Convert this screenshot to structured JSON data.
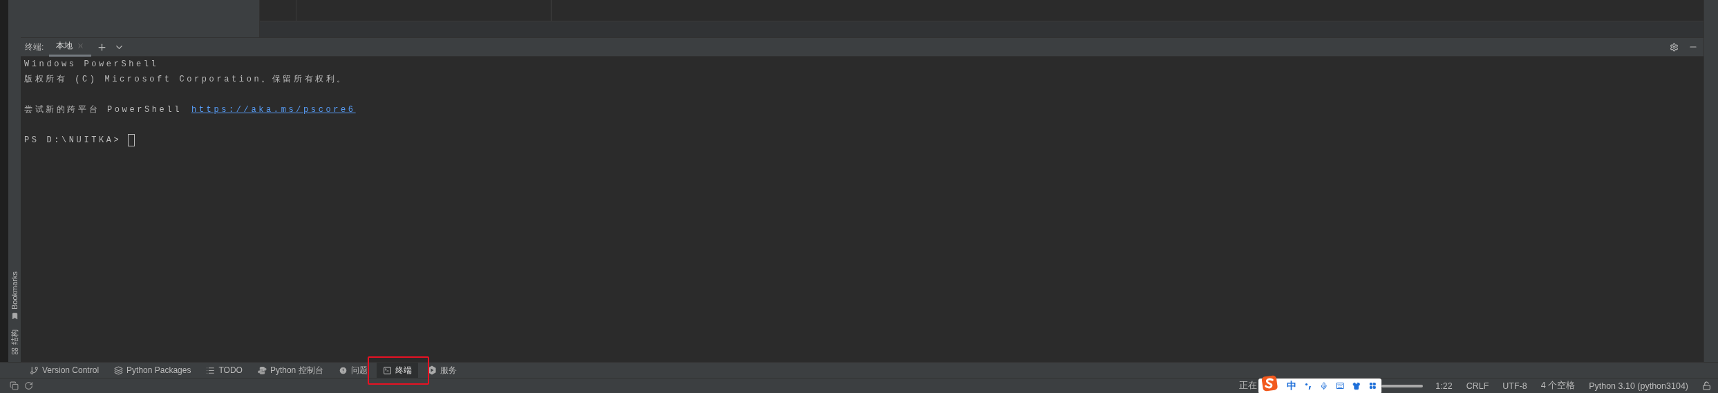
{
  "left_strip": [
    {
      "label": "Bookmarks",
      "kind": "bookmark"
    },
    {
      "label": "结构",
      "kind": "structure"
    }
  ],
  "terminal": {
    "label": "终端:",
    "tabs": [
      {
        "label": "本地",
        "selected": true
      }
    ],
    "lines": [
      {
        "kind": "text",
        "text": "Windows PowerShell"
      },
      {
        "kind": "text",
        "text": "版权所有 (C) Microsoft Corporation。保留所有权利。"
      },
      {
        "kind": "blank"
      },
      {
        "kind": "link_line",
        "text": "尝试新的跨平台 PowerShell",
        "link": "https://aka.ms/pscore6"
      },
      {
        "kind": "blank"
      },
      {
        "kind": "prompt",
        "text": "PS D:\\NUITKA>"
      }
    ]
  },
  "tool_tabs": [
    {
      "label": "Version Control",
      "kind": "branch",
      "selected": false,
      "highlighted": false
    },
    {
      "label": "Python Packages",
      "kind": "layers",
      "selected": false,
      "highlighted": false
    },
    {
      "label": "TODO",
      "kind": "list",
      "selected": false,
      "highlighted": false
    },
    {
      "label": "Python 控制台",
      "kind": "python",
      "selected": false,
      "highlighted": false
    },
    {
      "label": "问题",
      "kind": "alert",
      "selected": false,
      "highlighted": false
    },
    {
      "label": "终端",
      "kind": "terminal",
      "selected": true,
      "highlighted": true
    },
    {
      "label": "服务",
      "kind": "services",
      "selected": false,
      "highlighted": false
    }
  ],
  "status_bar": {
    "task": "正在",
    "ime": {
      "mode": "中"
    },
    "progress": {
      "level": 1
    },
    "items": [
      "1:22",
      "CRLF",
      "UTF-8",
      "4 个空格",
      "Python 3.10 (python3104)"
    ]
  }
}
